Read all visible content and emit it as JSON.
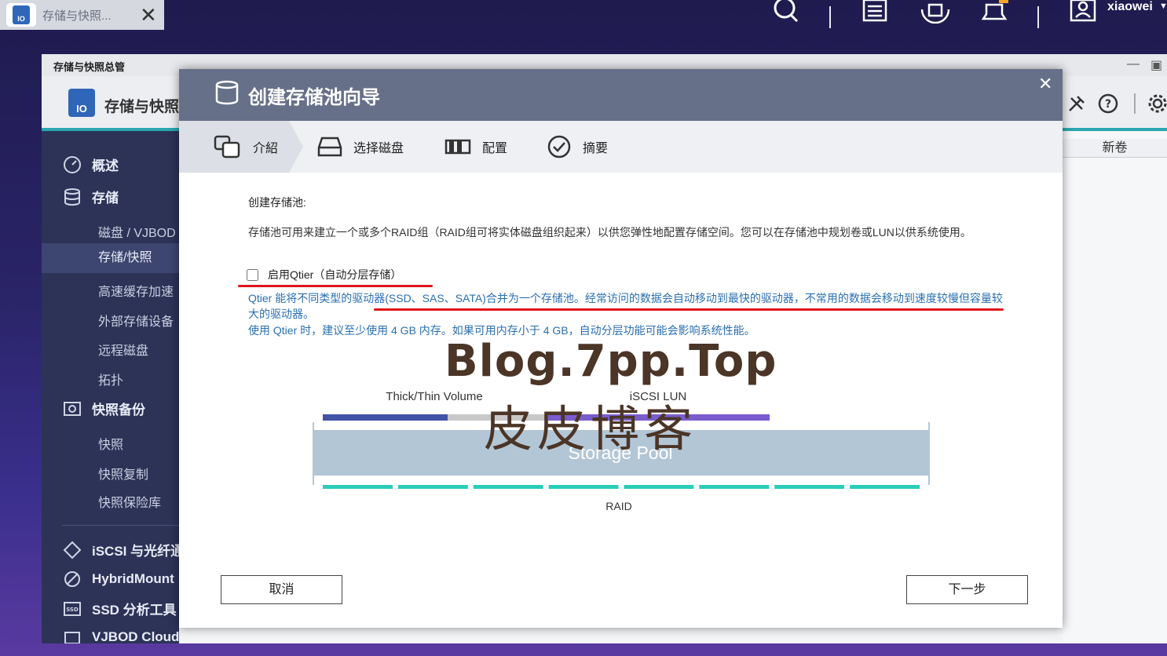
{
  "taskbar": {
    "tab_label": "存储与快照...",
    "icons": [
      "search-icon",
      "task-list-icon",
      "lock-icon",
      "bell-icon",
      "user-icon"
    ],
    "user_name": "xiaowei"
  },
  "background_window": {
    "title": "存储与快照总管",
    "app_title": "存储与快照",
    "sidebar": {
      "sections": [
        {
          "label": "概述",
          "icon": "dashboard-icon"
        },
        {
          "label": "存储",
          "icon": "database-icon"
        },
        {
          "label": "快照备份",
          "icon": "snapshot-icon"
        },
        {
          "label": "iSCSI 与光纤通道",
          "icon": "iscsi-icon"
        },
        {
          "label": "HybridMount",
          "icon": "hybridmount-icon"
        },
        {
          "label": "SSD 分析工具",
          "icon": "ssd-icon"
        },
        {
          "label": "VJBOD Cloud",
          "icon": "vjbod-cloud-icon"
        }
      ],
      "storage_items": [
        "磁盘 / VJBOD",
        "存储/快照",
        "高速缓存加速",
        "外部存储设备",
        "远程磁盘",
        "拓扑"
      ],
      "snapshot_items": [
        "快照",
        "快照复制",
        "快照保险库"
      ],
      "selected": "存储/快照"
    },
    "right_column_header": "新卷"
  },
  "wizard": {
    "title": "创建存储池向导",
    "steps": [
      {
        "label": "介紹",
        "icon": "intro-icon",
        "active": true
      },
      {
        "label": "选择磁盘",
        "icon": "disk-select-icon",
        "active": false
      },
      {
        "label": "配置",
        "icon": "config-icon",
        "active": false
      },
      {
        "label": "摘要",
        "icon": "summary-check-icon",
        "active": false
      }
    ],
    "heading": "创建存储池:",
    "description": "存储池可用来建立一个或多个RAID组（RAID组可将实体磁盘组织起来）以供您弹性地配置存储空间。您可以在存储池中规划卷或LUN以供系统使用。",
    "qtier_label": "启用Qtier（自动分层存储）",
    "qtier_checked": false,
    "note1": "Qtier 能将不同类型的驱动器(SSD、SAS、SATA)合并为一个存储池。经常访问的数据会自动移动到最快的驱动器，不常用的数据会移动到速度较慢但容量较大的驱动器。",
    "note2": "使用 Qtier 时，建议至少使用 4 GB 内存。如果可用内存小于 4 GB，自动分层功能可能会影响系统性能。",
    "diagram": {
      "thick_thin_label": "Thick/Thin Volume",
      "iscsi_label": "iSCSI LUN",
      "pool_label": "Storage Pool",
      "raid_label": "RAID",
      "colors": {
        "volume_used": "#4253a8",
        "volume_free": "#c8c8c8",
        "lun": "#7a5ccf",
        "pool": "#b3c6d6",
        "raid": "#29cdb8"
      },
      "raid_segments": 8
    },
    "cancel_label": "取消",
    "next_label": "下一步"
  },
  "watermark": {
    "line1": "Blog.7pp.Top",
    "line2": "皮皮博客"
  }
}
